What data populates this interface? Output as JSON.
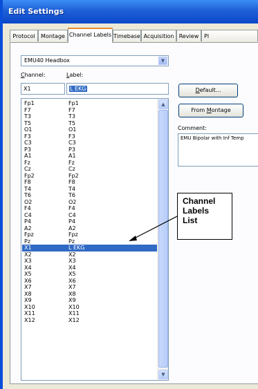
{
  "window": {
    "title": "Edit Settings"
  },
  "tabs": [
    {
      "label": "Protocol",
      "active": false
    },
    {
      "label": "Montage",
      "active": false
    },
    {
      "label": "Channel Labels",
      "active": true
    },
    {
      "label": "Timebase",
      "active": false
    },
    {
      "label": "Acquisition",
      "active": false
    },
    {
      "label": "Review",
      "active": false
    },
    {
      "label": "Pl",
      "active": false
    }
  ],
  "headbox": {
    "selected": "EMU40 Headbox"
  },
  "channel_field": {
    "label": "Channel:",
    "value": "X1"
  },
  "label_field": {
    "label": "Label:",
    "value": "L EKG"
  },
  "buttons": {
    "default": "Default...",
    "from_montage": "From Montage"
  },
  "comment": {
    "label": "Comment:",
    "value": "EMU Bipolar with Inf Temp"
  },
  "channel_list": {
    "rows": [
      {
        "channel": "Fp1",
        "label": "Fp1"
      },
      {
        "channel": "F7",
        "label": "F7"
      },
      {
        "channel": "T3",
        "label": "T3"
      },
      {
        "channel": "T5",
        "label": "T5"
      },
      {
        "channel": "O1",
        "label": "O1"
      },
      {
        "channel": "F3",
        "label": "F3"
      },
      {
        "channel": "C3",
        "label": "C3"
      },
      {
        "channel": "P3",
        "label": "P3"
      },
      {
        "channel": "A1",
        "label": "A1"
      },
      {
        "channel": "Fz",
        "label": "Fz"
      },
      {
        "channel": "Cz",
        "label": "Cz"
      },
      {
        "channel": "Fp2",
        "label": "Fp2"
      },
      {
        "channel": "F8",
        "label": "F8"
      },
      {
        "channel": "T4",
        "label": "T4"
      },
      {
        "channel": "T6",
        "label": "T6"
      },
      {
        "channel": "O2",
        "label": "O2"
      },
      {
        "channel": "F4",
        "label": "F4"
      },
      {
        "channel": "C4",
        "label": "C4"
      },
      {
        "channel": "P4",
        "label": "P4"
      },
      {
        "channel": "A2",
        "label": "A2"
      },
      {
        "channel": "Fpz",
        "label": "Fpz"
      },
      {
        "channel": "Pz",
        "label": "Pz"
      },
      {
        "channel": "X1",
        "label": "L EKG",
        "selected": true
      },
      {
        "channel": "X2",
        "label": "X2"
      },
      {
        "channel": "X3",
        "label": "X3"
      },
      {
        "channel": "X4",
        "label": "X4"
      },
      {
        "channel": "X5",
        "label": "X5"
      },
      {
        "channel": "X6",
        "label": "X6"
      },
      {
        "channel": "X7",
        "label": "X7"
      },
      {
        "channel": "X8",
        "label": "X8"
      },
      {
        "channel": "X9",
        "label": "X9"
      },
      {
        "channel": "X10",
        "label": "X10"
      },
      {
        "channel": "X11",
        "label": "X11"
      },
      {
        "channel": "X12",
        "label": "X12"
      }
    ]
  },
  "annotation": {
    "lines": [
      "Channel",
      "Labels",
      "List"
    ]
  },
  "icons": {
    "dropdown": "chevron-down-icon",
    "scroll_up": "scroll-up-arrow-icon",
    "scroll_down": "scroll-down-arrow-icon"
  },
  "colors": {
    "titlebar": "#1E5FD6",
    "selection": "#316AC5",
    "active_tab_accent": "#E68B2C"
  }
}
